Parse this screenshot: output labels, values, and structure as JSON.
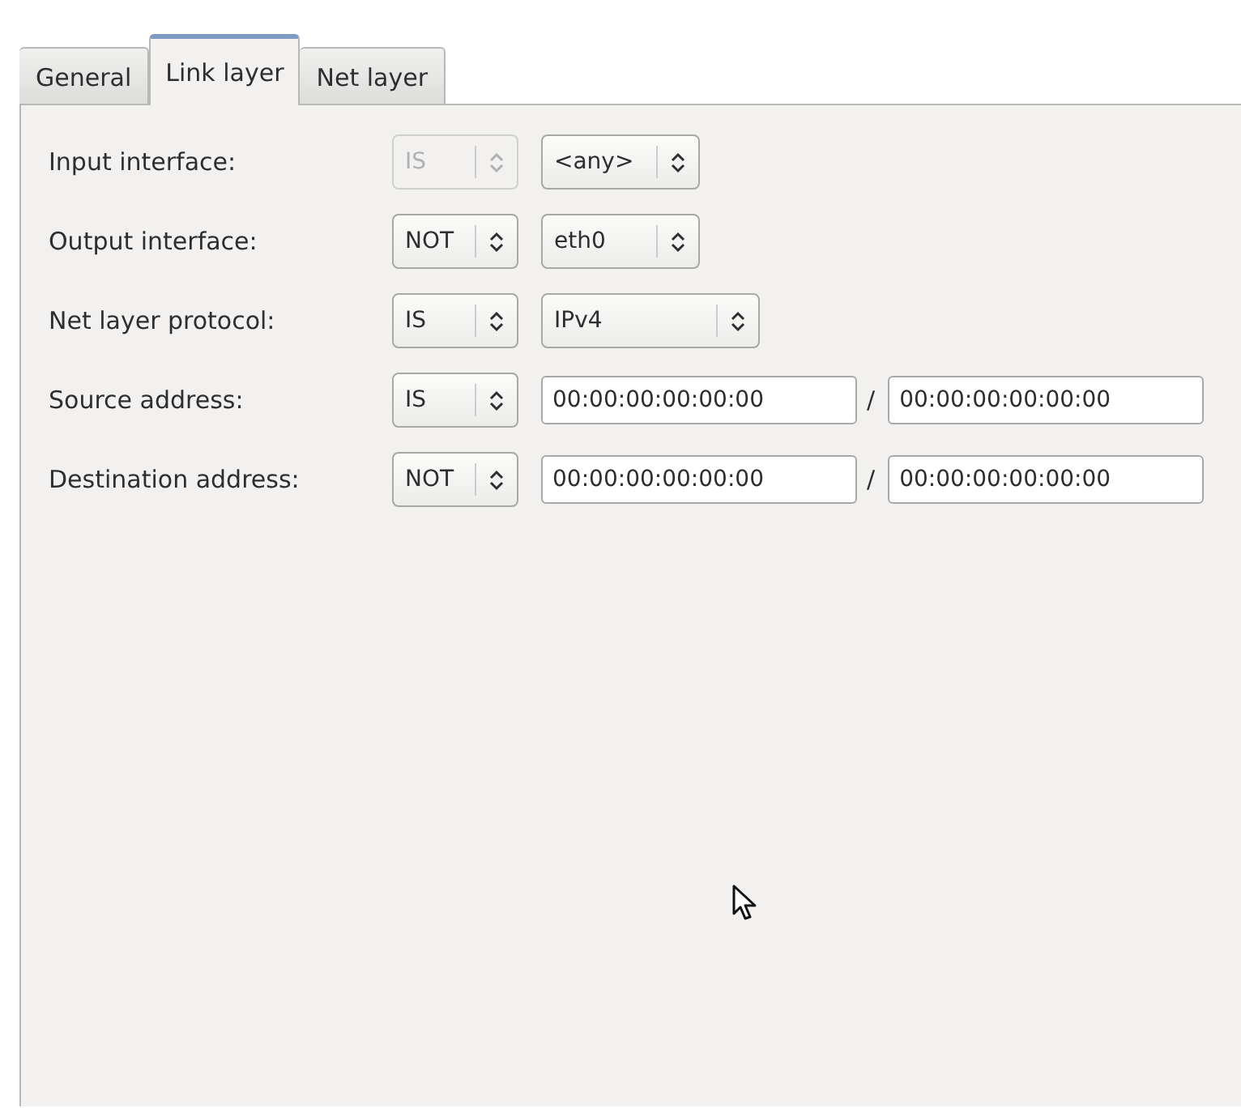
{
  "tabs": [
    {
      "label": "General",
      "selected": false
    },
    {
      "label": "Link layer",
      "selected": true
    },
    {
      "label": "Net layer",
      "selected": false
    }
  ],
  "rows": [
    {
      "label": "Input interface:",
      "operator": {
        "value": "IS",
        "disabled": true
      },
      "kind": "combo",
      "value": "<any>"
    },
    {
      "label": "Output interface:",
      "operator": {
        "value": "NOT",
        "disabled": false
      },
      "kind": "combo",
      "value": "eth0"
    },
    {
      "label": "Net layer protocol:",
      "operator": {
        "value": "IS",
        "disabled": false
      },
      "kind": "wide-combo",
      "value": "IPv4"
    },
    {
      "label": "Source address:",
      "operator": {
        "value": "IS",
        "disabled": false
      },
      "kind": "address",
      "value": "00:00:00:00:00:00",
      "separator": "/",
      "mask": "00:00:00:00:00:00"
    },
    {
      "label": "Destination address:",
      "operator": {
        "value": "NOT",
        "disabled": false
      },
      "kind": "address",
      "value": "00:00:00:00:00:00",
      "separator": "/",
      "mask": "00:00:00:00:00:00"
    }
  ]
}
